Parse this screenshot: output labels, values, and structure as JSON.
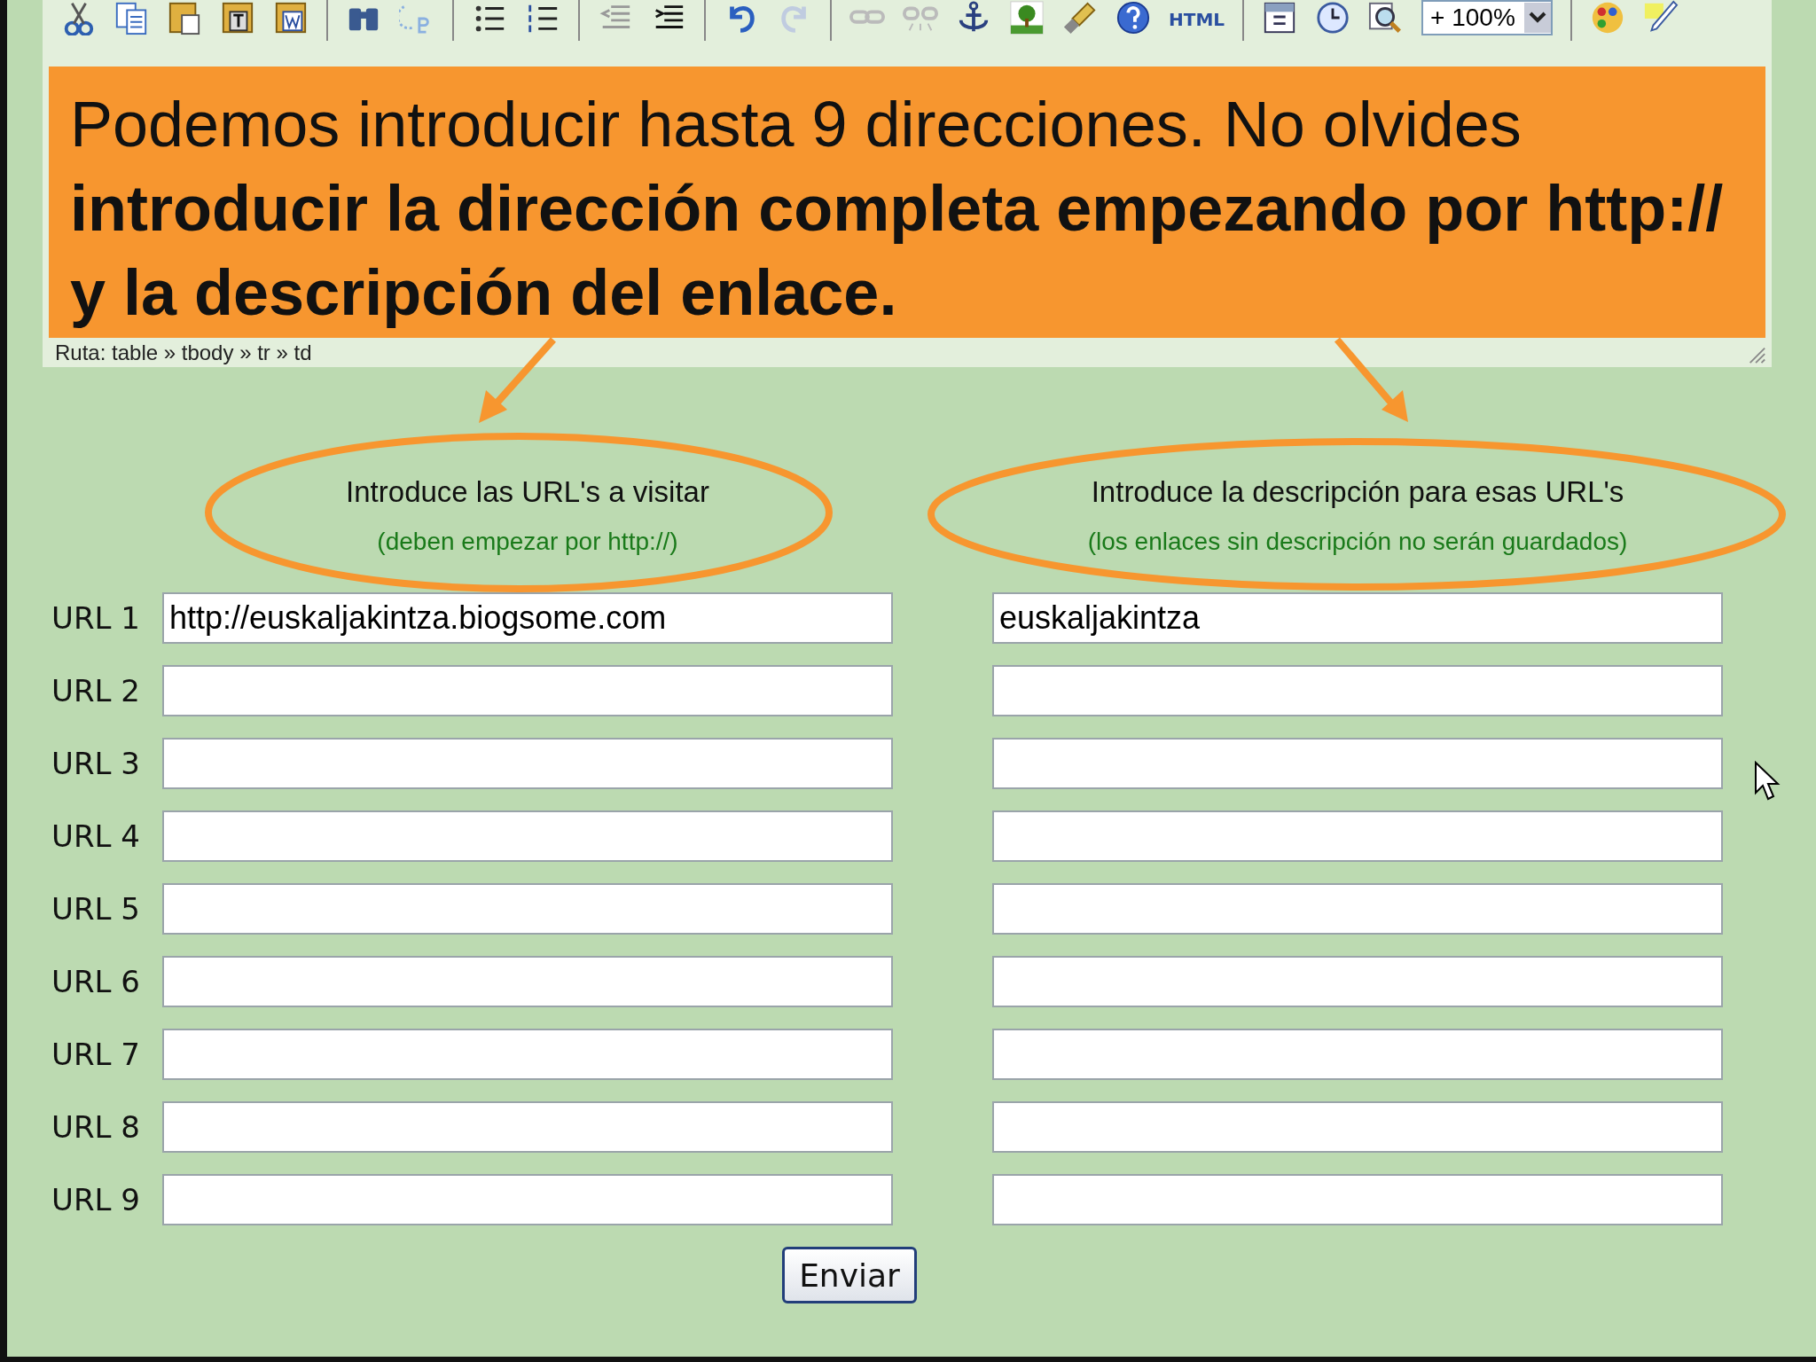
{
  "toolbar": {
    "html_label": "HTML",
    "zoom": "+ 100%"
  },
  "path_bar": {
    "text": "Ruta: table » tbody » tr » td"
  },
  "callout": {
    "text": "Podemos introducir hasta 9 direcciones. No olvides **introducir la dirección completa empezando por http:// y la descripción del enlace.**"
  },
  "form": {
    "url_header": "Introduce las URL's a visitar",
    "url_hint": "(deben empezar por http://)",
    "description_header": "Introduce la descripción para esas URL's",
    "description_hint": "(los enlaces sin descripción no serán guardados)",
    "rows": [
      {
        "label": "URL 1",
        "url": "http://euskaljakintza.biogsome.com",
        "description": "euskaljakintza"
      },
      {
        "label": "URL 2"
      },
      {
        "label": "URL 3"
      },
      {
        "label": "URL 4"
      },
      {
        "label": "URL 5"
      },
      {
        "label": "URL 6"
      },
      {
        "label": "URL 7"
      },
      {
        "label": "URL 8"
      },
      {
        "label": "URL 9"
      }
    ],
    "submit": "Enviar"
  }
}
